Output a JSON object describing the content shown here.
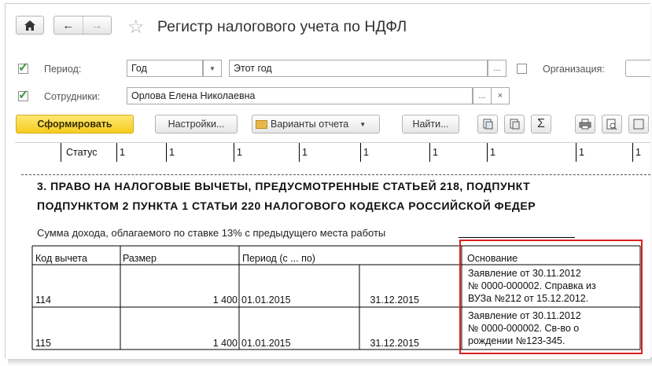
{
  "title": "Регистр налогового учета по НДФЛ",
  "period": {
    "label": "Период:",
    "type_value": "Год",
    "value": "Этот год",
    "btn": "..."
  },
  "org": {
    "label": "Организация:"
  },
  "employees": {
    "label": "Сотрудники:",
    "value": "Орлова Елена Николаевна",
    "btn": "...",
    "clear": "×"
  },
  "toolbar": {
    "generate": "Сформировать",
    "settings": "Настройки...",
    "variants": "Варианты отчета",
    "find": "Найти...",
    "sum": "Σ"
  },
  "report": {
    "status_row": {
      "label": "Статус",
      "values": [
        "1",
        "1",
        "1",
        "1",
        "1",
        "1",
        "1",
        "1",
        "1"
      ]
    },
    "section_line1": "3. ПРАВО НА НАЛОГОВЫЕ ВЫЧЕТЫ, ПРЕДУСМОТРЕННЫЕ СТАТЬЕЙ  218, ПОДПУНКТ",
    "section_line2": "ПОДПУНКТОМ 2 ПУНКТА 1 СТАТЬИ 220 НАЛОГОВОГО КОДЕКСА РОССИЙСКОЙ ФЕДЕР",
    "income_text": "Сумма дохода, облагаемого по ставке 13% с предыдущего места работы",
    "headers": {
      "code": "Код вычета",
      "size": "Размер",
      "period": "Период (с ... по)",
      "basis": "Основание"
    },
    "rows": [
      {
        "code": "114",
        "size": "1 400",
        "from": "01.01.2015",
        "to": "31.12.2015",
        "basis": [
          "Заявление от 30.11.2012",
          "№ 0000-000002. Справка из",
          "ВУЗа №212 от 15.12.2012."
        ]
      },
      {
        "code": "115",
        "size": "1 400",
        "from": "01.01.2015",
        "to": "31.12.2015",
        "basis": [
          "Заявление от 30.11.2012",
          "№ 0000-000002. Св-во о",
          "рождении №123-345."
        ]
      }
    ]
  }
}
